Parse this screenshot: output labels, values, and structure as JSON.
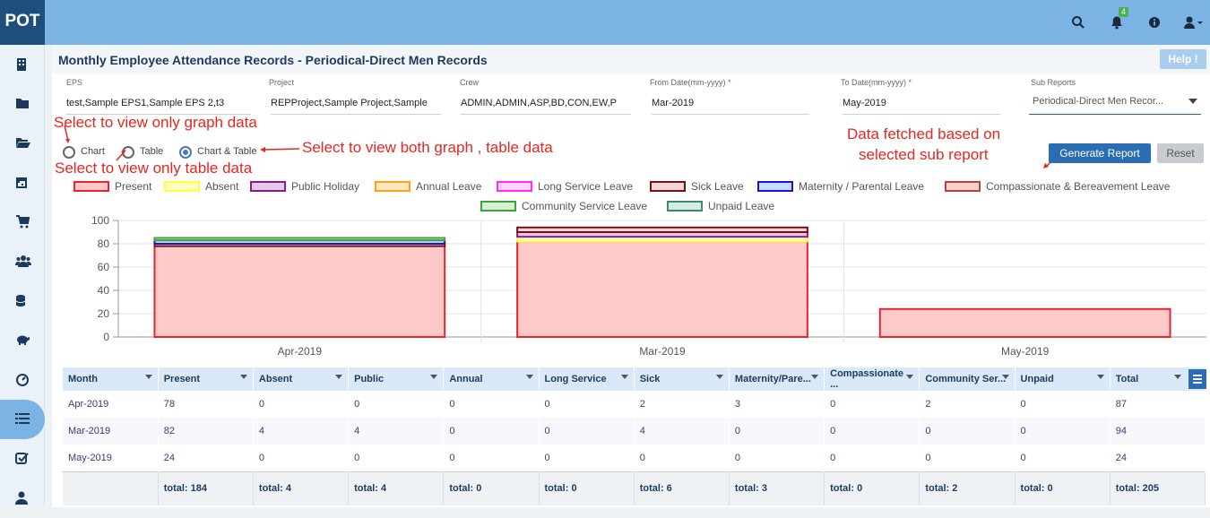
{
  "app": {
    "logo": "POT",
    "notification_count": "4"
  },
  "header": {
    "icons": [
      "search-icon",
      "bell-icon",
      "info-icon",
      "user-icon"
    ]
  },
  "sidebar": {
    "icons": [
      "building-icon",
      "folder-icon",
      "folder-open-icon",
      "calendar-icon",
      "cart-icon",
      "users-icon",
      "database-icon",
      "piggy-bank-icon",
      "dashboard-icon",
      "list-icon",
      "check-square-icon",
      "user-icon"
    ],
    "active_index": 9
  },
  "page": {
    "title": "Monthly Employee Attendance Records - Periodical-Direct Men Records",
    "help_label": "Help !"
  },
  "filters": {
    "eps": {
      "label": "EPS",
      "value": "test,Sample EPS1,Sample EPS 2,t3"
    },
    "project": {
      "label": "Project",
      "value": "REPProject,Sample Project,Sample"
    },
    "crew": {
      "label": "Crew",
      "value": "ADMIN,ADMIN,ASP,BD,CON,EW,P"
    },
    "from_date": {
      "label": "From Date(mm-yyyy)",
      "required": "*",
      "value": "Mar-2019"
    },
    "to_date": {
      "label": "To Date(mm-yyyy)",
      "required": "*",
      "value": "May-2019"
    },
    "sub_reports": {
      "label": "Sub Reports",
      "value": "Periodical-Direct Men Recor..."
    }
  },
  "view_options": {
    "chart": "Chart",
    "table": "Table",
    "chart_table": "Chart & Table",
    "selected": "chart_table"
  },
  "buttons": {
    "generate": "Generate Report",
    "reset": "Reset"
  },
  "annotations": {
    "graph": "Select to view only graph data",
    "table": "Select to view only table data",
    "both": "Select to view both graph , table data",
    "subreport_1": "Data fetched based on",
    "subreport_2": "selected sub report"
  },
  "colors": {
    "accent": "#2b6db3",
    "topbar": "#7bb3e4",
    "annotation": "#e8261f"
  },
  "chart_data": {
    "type": "bar",
    "stacked": true,
    "categories": [
      "Apr-2019",
      "Mar-2019",
      "May-2019"
    ],
    "ylim": [
      0,
      100
    ],
    "yticks": [
      "0",
      "20",
      "40",
      "60",
      "80",
      "100"
    ],
    "grid": true,
    "legend_position": "top",
    "series": [
      {
        "name": "Present",
        "color": "#e8262a",
        "fill": "#ffc9c9",
        "values": [
          78,
          82,
          24
        ]
      },
      {
        "name": "Absent",
        "color": "#ffff3b",
        "fill": "#ffffc4",
        "values": [
          0,
          4,
          0
        ]
      },
      {
        "name": "Public Holiday",
        "color": "#8b1a8b",
        "fill": "#e6c8ee",
        "values": [
          0,
          4,
          0
        ]
      },
      {
        "name": "Annual Leave",
        "color": "#ffa31a",
        "fill": "#ffe6c2",
        "values": [
          0,
          0,
          0
        ]
      },
      {
        "name": "Long Service Leave",
        "color": "#ff2bff",
        "fill": "#ffd2ff",
        "values": [
          0,
          0,
          0
        ]
      },
      {
        "name": "Sick Leave",
        "color": "#7b0d15",
        "fill": "#f1d6d6",
        "values": [
          2,
          4,
          0
        ]
      },
      {
        "name": "Maternity / Parental Leave",
        "color": "#1717c7",
        "fill": "#c8d8ff",
        "values": [
          3,
          0,
          0
        ]
      },
      {
        "name": "Compassionate & Bereavement Leave",
        "color": "#c43c3c",
        "fill": "#f6cfcf",
        "values": [
          0,
          0,
          0
        ]
      },
      {
        "name": "Community Service Leave",
        "color": "#3ea33e",
        "fill": "#d6f0d6",
        "values": [
          2,
          0,
          0
        ]
      },
      {
        "name": "Unpaid Leave",
        "color": "#3b8a6a",
        "fill": "#d5ece3",
        "values": [
          0,
          0,
          0
        ]
      }
    ]
  },
  "table": {
    "columns": [
      "Month",
      "Present",
      "Absent",
      "Public",
      "Annual",
      "Long Service",
      "Sick",
      "Maternity/Pare...",
      "Compassionate ...",
      "Community Ser...",
      "Unpaid",
      "Total"
    ],
    "rows": [
      [
        "Apr-2019",
        "78",
        "0",
        "0",
        "0",
        "0",
        "2",
        "3",
        "0",
        "2",
        "0",
        "87"
      ],
      [
        "Mar-2019",
        "82",
        "4",
        "4",
        "0",
        "0",
        "4",
        "0",
        "0",
        "0",
        "0",
        "94"
      ],
      [
        "May-2019",
        "24",
        "0",
        "0",
        "0",
        "0",
        "0",
        "0",
        "0",
        "0",
        "0",
        "24"
      ]
    ],
    "totals": [
      "",
      "total: 184",
      "total: 4",
      "total: 4",
      "total: 0",
      "total: 0",
      "total: 6",
      "total: 3",
      "total: 0",
      "total: 2",
      "total: 0",
      "total: 205"
    ]
  }
}
